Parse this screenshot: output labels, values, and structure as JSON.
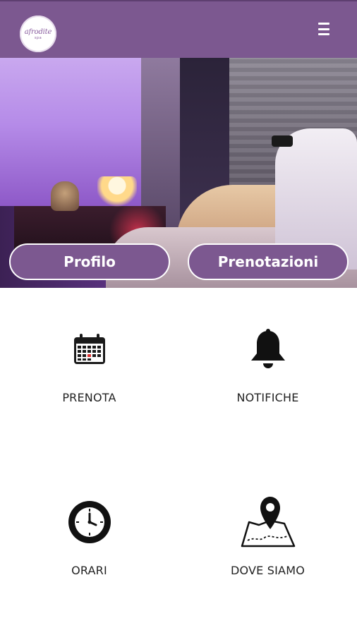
{
  "header": {
    "logo_text": "afrodite",
    "logo_subtext": "spa",
    "menu_icon": "hamburger-menu-icon",
    "bar_color": "#7c5890"
  },
  "hero": {
    "buttons": [
      {
        "label": "Profilo"
      },
      {
        "label": "Prenotazioni"
      }
    ]
  },
  "tiles": [
    {
      "label": "PRENOTA",
      "icon": "calendar-icon"
    },
    {
      "label": "NOTIFICHE",
      "icon": "bell-icon"
    },
    {
      "label": "ORARI",
      "icon": "clock-icon"
    },
    {
      "label": "DOVE SIAMO",
      "icon": "map-pin-icon"
    }
  ]
}
